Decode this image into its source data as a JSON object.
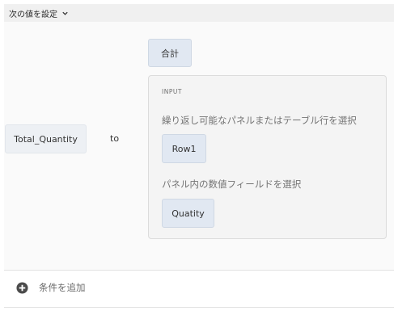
{
  "header": {
    "title": "次の値を設定",
    "toggle_icon": "chevron-down-icon"
  },
  "field_chip": {
    "label": "Total_Quantity"
  },
  "connector": {
    "label": "to"
  },
  "function_chip": {
    "label": "合計"
  },
  "input_panel": {
    "title": "INPUT",
    "repeatable_prompt": "繰り返し可能なパネルまたはテーブル行を選択",
    "repeatable_value": "Row1",
    "numeric_prompt": "パネル内の数値フィールドを選択",
    "numeric_value": "Quatity"
  },
  "add_condition": {
    "label": "条件を追加",
    "icon": "plus-circle-icon"
  },
  "colors": {
    "chip_bg": "#e1e8f2",
    "panel_bg": "#f4f4f4",
    "header_bg": "#f0f0f0"
  }
}
